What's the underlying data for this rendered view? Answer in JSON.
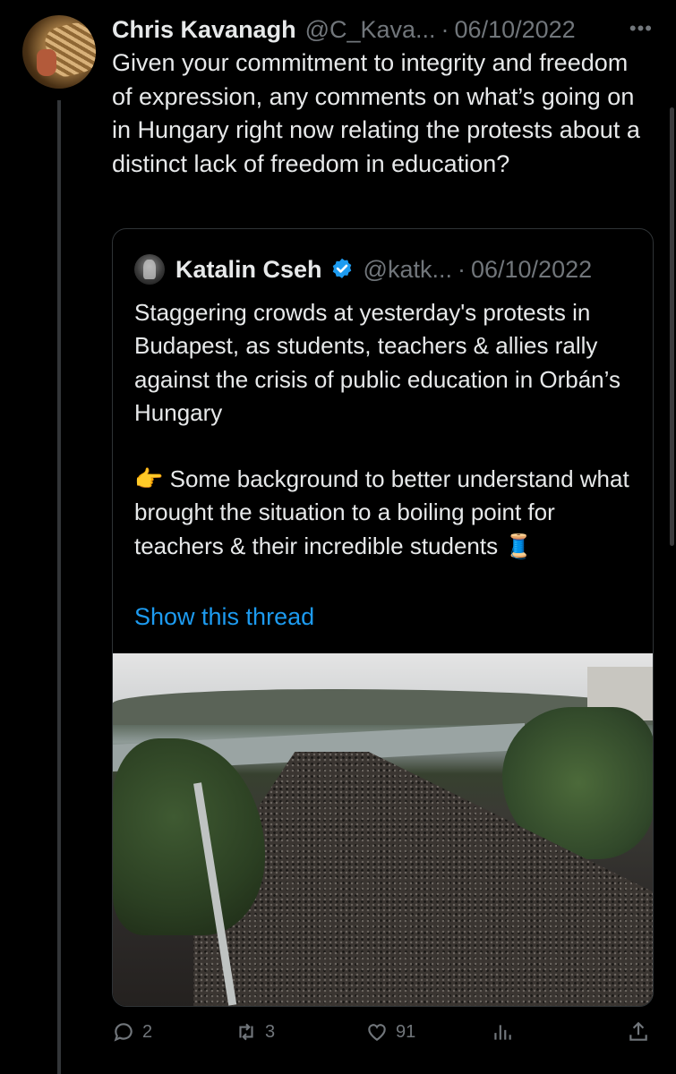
{
  "tweet": {
    "author_name": "Chris Kavanagh",
    "author_handle": "@C_Kava...",
    "separator": "·",
    "date": "06/10/2022",
    "text": "Given your commitment to integrity and freedom of expression, any comments on what’s going on in Hungary right now relating the protests about a distinct lack of freedom in education?"
  },
  "quote": {
    "author_name": "Katalin Cseh",
    "author_handle": "@katk...",
    "separator": "·",
    "date": "06/10/2022",
    "paragraph_1": "Staggering crowds at yesterday's protests in Budapest, as students, teachers & allies rally against the crisis of public education in Orbán’s Hungary",
    "paragraph_2": "👉 Some background to better understand what brought the situation to a boiling point for teachers & their incredible students 🧵",
    "show_thread_label": "Show this thread"
  },
  "actions": {
    "replies": "2",
    "retweets": "3",
    "likes": "91"
  },
  "colors": {
    "background": "#000000",
    "text": "#e7e9ea",
    "muted": "#71767b",
    "link": "#1d9bf0",
    "border": "#2f3336"
  },
  "icons": [
    "more-icon",
    "verified-icon",
    "reply-icon",
    "retweet-icon",
    "like-icon",
    "views-icon",
    "share-icon"
  ]
}
